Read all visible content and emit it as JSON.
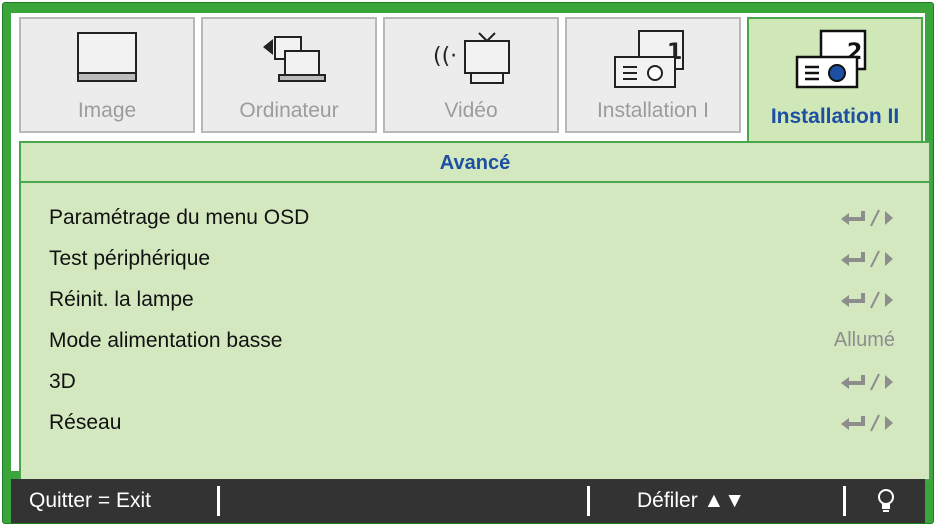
{
  "tabs": [
    {
      "label": "Image",
      "icon": "monitor-icon",
      "active": false
    },
    {
      "label": "Ordinateur",
      "icon": "computer-icon",
      "active": false
    },
    {
      "label": "Vidéo",
      "icon": "video-icon",
      "active": false
    },
    {
      "label": "Installation I",
      "icon": "projector-icon",
      "active": false
    },
    {
      "label": "Installation II",
      "icon": "projector-2-icon",
      "active": true
    }
  ],
  "panel": {
    "title": "Avancé",
    "items": [
      {
        "label": "Paramétrage du menu OSD",
        "value_icon": "enter-arrow-icon"
      },
      {
        "label": "Test périphérique",
        "value_icon": "enter-arrow-icon"
      },
      {
        "label": "Réinit. la lampe",
        "value_icon": "enter-arrow-icon"
      },
      {
        "label": "Mode alimentation basse",
        "value": "Allumé"
      },
      {
        "label": "3D",
        "value_icon": "enter-arrow-icon"
      },
      {
        "label": "Réseau",
        "value_icon": "enter-arrow-icon"
      }
    ]
  },
  "footer": {
    "exit": "Quitter = Exit",
    "scroll": "Défiler ▲▼",
    "help_icon": "lightbulb-icon"
  },
  "colors": {
    "frame": "#39a53a",
    "panel": "#d3e8bf",
    "accent_text": "#1d4fa3",
    "footer": "#333333"
  }
}
